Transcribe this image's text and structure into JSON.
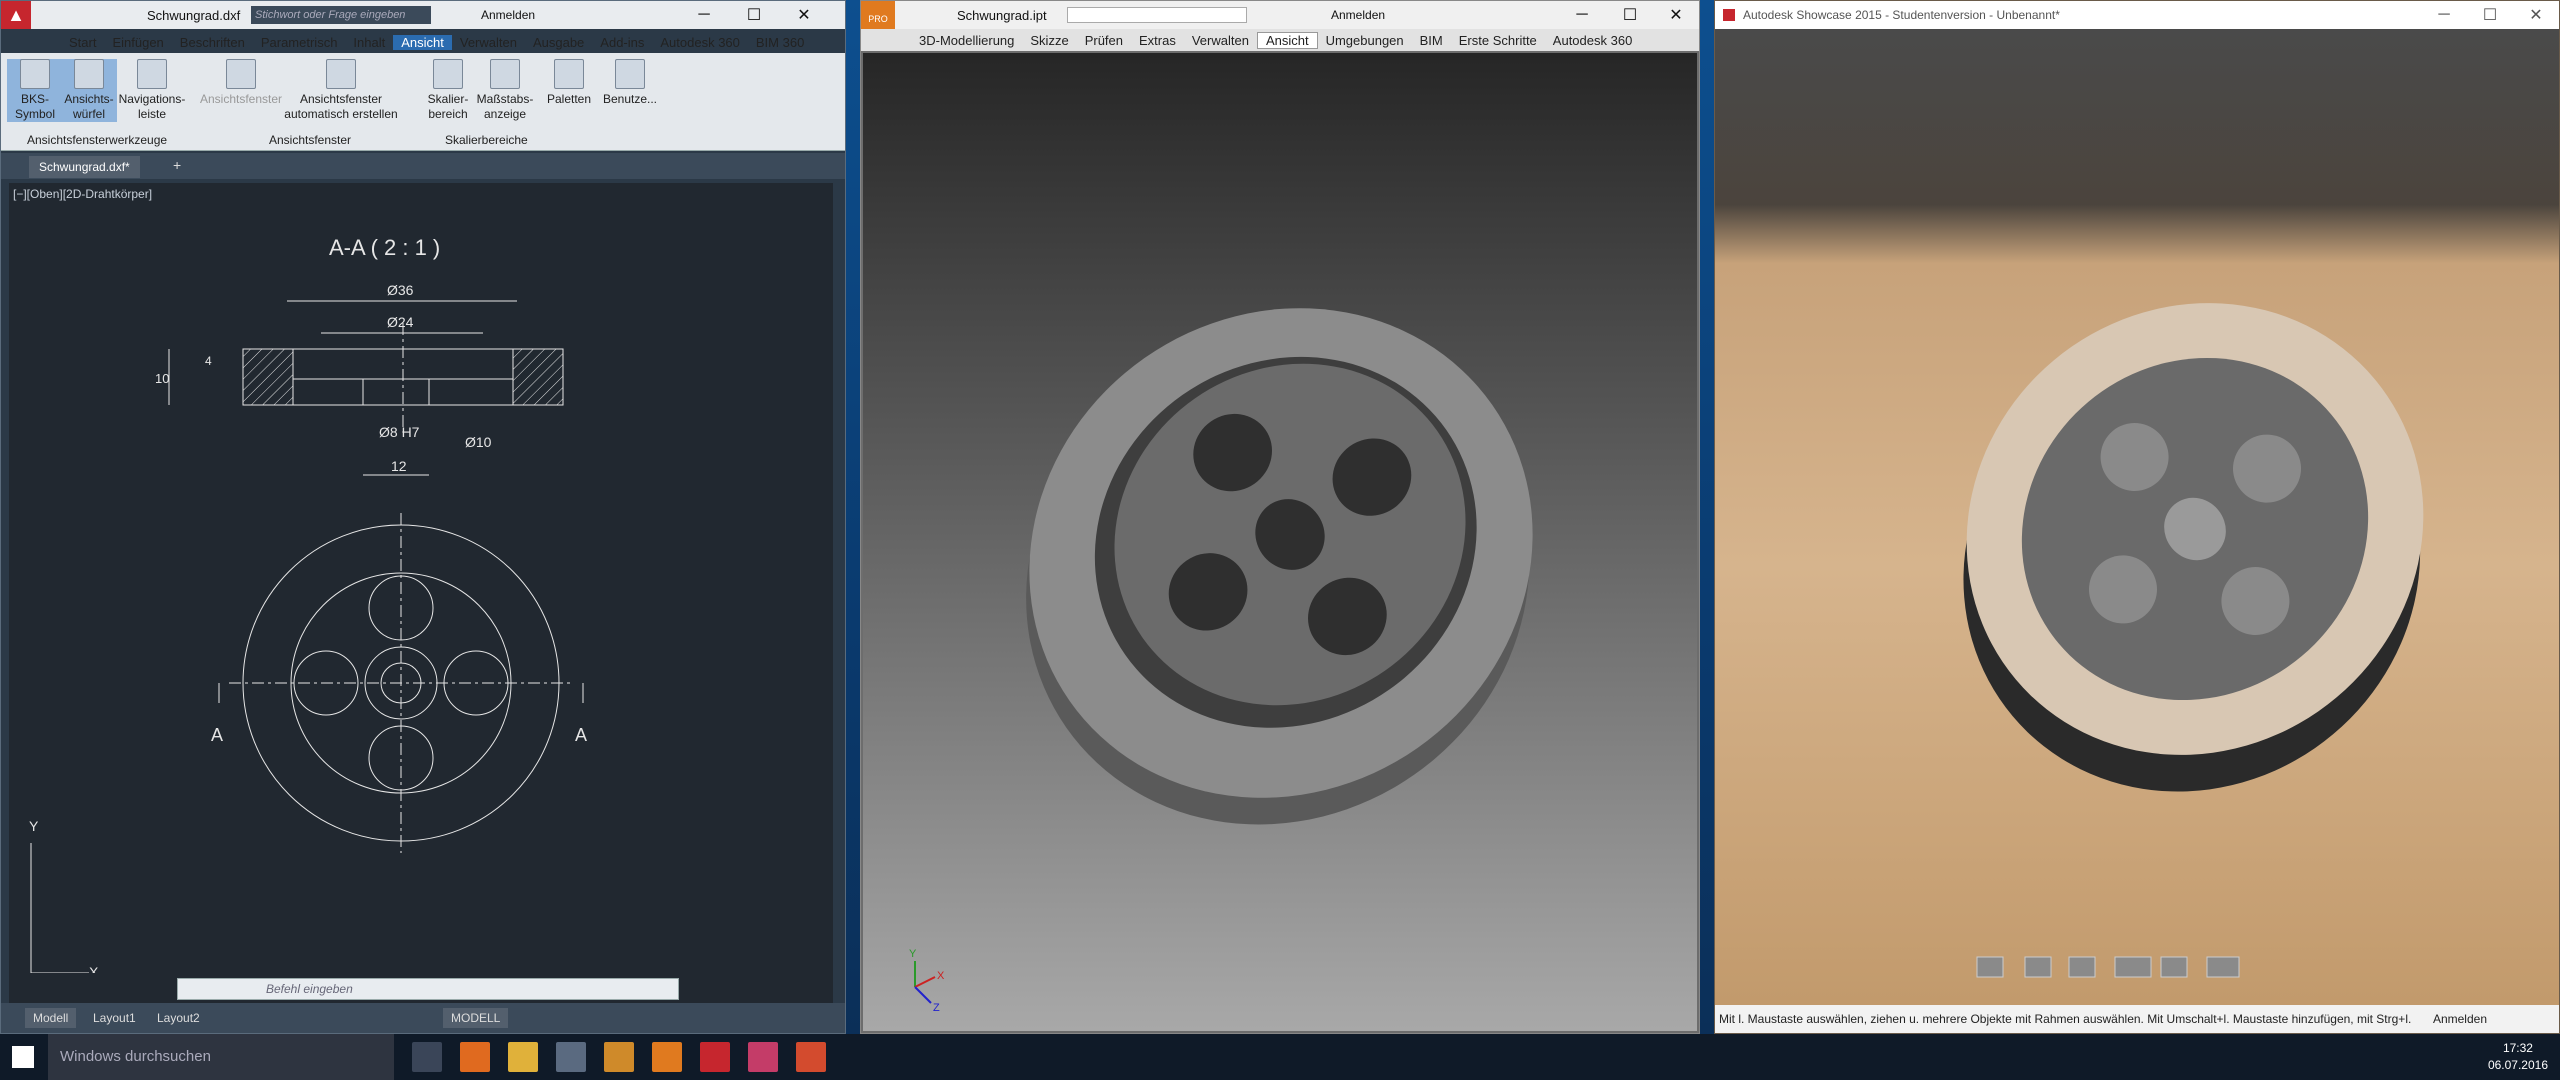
{
  "acad": {
    "title": "Schwungrad.dxf",
    "search_placeholder": "Stichwort oder Frage eingeben",
    "signin": "Anmelden",
    "tabs": [
      "Start",
      "Einfügen",
      "Beschriften",
      "Parametrisch",
      "Inhalt",
      "Ansicht",
      "Verwalten",
      "Ausgabe",
      "Add-ins",
      "Autodesk 360",
      "BIM 360"
    ],
    "buttons": {
      "bks": "BKS-Symbol",
      "cube": "Ansichts-würfel",
      "nav": "Navigations-leiste",
      "vpf": "Ansichtsfenster",
      "auto": "Ansichtsfenster automatisch erstellen",
      "scale": "Skalier-bereich",
      "mass": "Maßstabs-anzeige",
      "pal": "Paletten",
      "user": "Benutze..."
    },
    "panels": {
      "tools": "Ansichtsfensterwerkzeuge",
      "vp": "Ansichtsfenster",
      "scale": "Skalierbereiche"
    },
    "doc_tab": "Schwungrad.dxf*",
    "viewport_label": "[−][Oben][2D-Drahtkörper]",
    "drawing": {
      "section": "A-A ( 2 : 1 )",
      "d36": "Ø36",
      "d24": "Ø24",
      "d8": "Ø8 H7",
      "d10": "Ø10",
      "h10": "10",
      "w12": "12",
      "h4": "4",
      "a": "A",
      "y": "Y",
      "x": "X"
    },
    "command_placeholder": "Befehl eingeben",
    "layouts": [
      "Modell",
      "Layout1",
      "Layout2"
    ],
    "status_model": "MODELL"
  },
  "inventor": {
    "title": "Schwungrad.ipt",
    "signin": "Anmelden",
    "pro": "PRO",
    "menu": [
      "3D-Modellierung",
      "Skizze",
      "Prüfen",
      "Extras",
      "Verwalten",
      "Ansicht",
      "Umgebungen",
      "BIM",
      "Erste Schritte",
      "Autodesk 360"
    ],
    "axes": {
      "x": "X",
      "y": "Y",
      "z": "Z"
    }
  },
  "showcase": {
    "title": "Autodesk Showcase 2015 - Studentenversion - Unbenannt*",
    "status": "Mit l. Maustaste auswählen, ziehen u. mehrere Objekte mit Rahmen auswählen. Mit Umschalt+l. Maustaste hinzufügen, mit Strg+l.",
    "signin": "Anmelden"
  },
  "taskbar": {
    "search": "Windows durchsuchen",
    "time": "17:32",
    "date": "06.07.2016"
  },
  "colors": {
    "acad_accent": "#2b6cb0",
    "taskbar": "#0f1a28"
  }
}
